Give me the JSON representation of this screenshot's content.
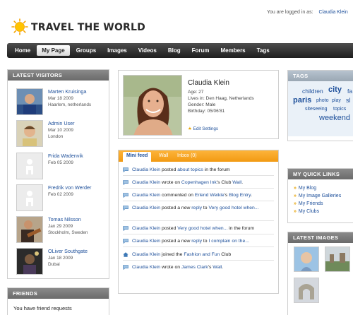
{
  "header": {
    "logo_text": "TRAVEL THE WORLD",
    "login_prefix": "You are logged in as:",
    "login_user": "Claudia Klein"
  },
  "nav": [
    "Home",
    "My Page",
    "Groups",
    "Images",
    "Videos",
    "Blog",
    "Forum",
    "Members",
    "Tags"
  ],
  "nav_active": "My Page",
  "latest_visitors": {
    "title": "LATEST VISITORS",
    "items": [
      {
        "name": "Marten Kruisinga",
        "date": "Mar 18 2009",
        "location": "Haarlem, netherlands",
        "avatar": "photo-man-blue"
      },
      {
        "name": "Admin User",
        "date": "Mar 10 2009",
        "location": "London",
        "avatar": "photo-man-smile"
      },
      {
        "name": "Frida Wadenvik",
        "date": "Feb 05 2009",
        "location": "",
        "avatar": "placeholder-silhouette"
      },
      {
        "name": "Fredrik von Werder",
        "date": "Feb 02 2009",
        "location": "",
        "avatar": "placeholder-silhouette"
      },
      {
        "name": "Tomas Nilsson",
        "date": "Jan 29 2009",
        "location": "Stockholm, Sweden",
        "avatar": "photo-guitar"
      },
      {
        "name": "OLiver Southgate",
        "date": "Jan 18 2009",
        "location": "Dubai",
        "avatar": "photo-dark"
      }
    ]
  },
  "friends": {
    "title": "FRIENDS",
    "message": "You have friend requests"
  },
  "profile": {
    "name": "Claudia Klein",
    "age": "Age: 27",
    "lives_in": "Lives in:  Den Haag, Netherlands",
    "gender": "Gender: Male",
    "birthday": "Birthday: 05/06'81",
    "edit_settings": "Edit Settings"
  },
  "feed": {
    "tabs": [
      "Mini feed",
      "Wall",
      "Inbox (0)"
    ],
    "items": [
      {
        "icon": "comment-icon",
        "parts": [
          "Claudia Klein",
          " posted ",
          "about topics",
          " in the forum"
        ]
      },
      {
        "icon": "comment-icon",
        "parts": [
          "Claudia Klein",
          " wrote on ",
          "Copenhagen Ink",
          "'s Club ",
          "Wall",
          "."
        ]
      },
      {
        "icon": "comment-icon",
        "parts": [
          "Claudia Klein",
          " commented on ",
          "Erlend Weikle",
          "'s ",
          "Blog Entry",
          "."
        ]
      },
      {
        "icon": "comment-icon",
        "parts": [
          "Claudia Klein",
          " posted a new ",
          "reply",
          " to ",
          "Very good hotel when...",
          ""
        ]
      },
      {
        "icon": "comment-icon",
        "parts": [
          "Claudia Klein",
          " posted ",
          "Very good hotel when...",
          " in the forum"
        ]
      },
      {
        "icon": "comment-icon",
        "parts": [
          "Claudia Klein",
          " posted a new ",
          "reply",
          " to ",
          "I complain on the...",
          ""
        ]
      },
      {
        "icon": "house-icon",
        "parts": [
          "Claudia Klein",
          " joined the ",
          "Fashion and Fun",
          " Club"
        ]
      },
      {
        "icon": "comment-icon",
        "parts": [
          "Claudia Klein",
          " wrote on ",
          "James Clark",
          "'s ",
          "Wall",
          "."
        ]
      }
    ]
  },
  "tags": {
    "title": "TAGS",
    "words": [
      "children",
      "city",
      "fa",
      "paris",
      "photo",
      "play",
      "sl",
      "siteseeing",
      "topics",
      "weekend"
    ]
  },
  "quick_links": {
    "title": "MY QUICK LINKS",
    "items": [
      "My Blog",
      "My Image Galleries",
      "My Friends",
      "My Clubs"
    ]
  },
  "latest_images": {
    "title": "LATEST IMAGES"
  },
  "colors": {
    "link": "#1d4f9a",
    "accent_orange": "#f29a12",
    "nav_dark": "#1e1e1e"
  }
}
